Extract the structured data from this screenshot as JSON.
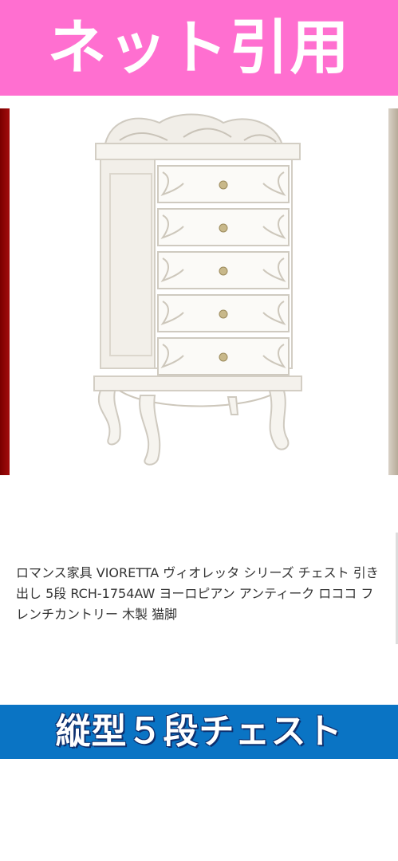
{
  "top_banner": {
    "text": "ネット引用",
    "background": "#ff6fd0"
  },
  "product": {
    "title": "ロマンス家具 VIORETTA ヴィオレッタ シリーズ チェスト 引き出し 5段 RCH-1754AW ヨーロピアン アンティーク ロココ フレンチカントリー 木製 猫脚",
    "image_alt": "white rococo 5-drawer chest"
  },
  "bottom_banner": {
    "text": "縦型５段チェスト",
    "background": "#0a74c4"
  }
}
